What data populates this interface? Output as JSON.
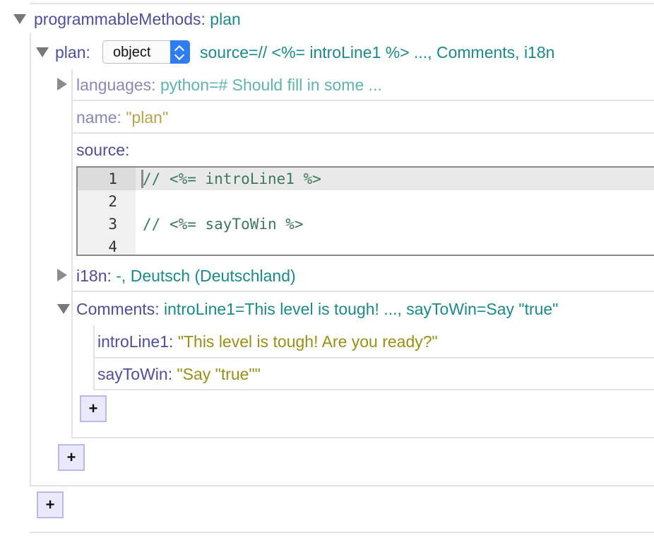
{
  "root": {
    "key": "programmableMethods",
    "summary": "plan"
  },
  "plan": {
    "key": "plan",
    "type_select": "object",
    "summary": "source=// <%= introLine1 %> ..., Comments, i18n",
    "languages": {
      "key": "languages",
      "summary": "python=# Should fill in some ..."
    },
    "name": {
      "key": "name",
      "value": "\"plan\""
    },
    "source": {
      "key": "source",
      "lines": [
        {
          "num": "1",
          "text": "// <%= introLine1 %>"
        },
        {
          "num": "2",
          "text": ""
        },
        {
          "num": "3",
          "text": "// <%= sayToWin %>"
        },
        {
          "num": "4",
          "text": ""
        }
      ]
    },
    "i18n": {
      "key": "i18n",
      "summary": "-, Deutsch (Deutschland)"
    },
    "comments": {
      "key": "Comments",
      "summary": "introLine1=This level is tough! ..., sayToWin=Say \"true\"",
      "intro": {
        "key": "introLine1",
        "value": "\"This level is tough! Are you ready?\""
      },
      "saytowin": {
        "key": "sayToWin",
        "value": "\"Say \"true\"\""
      }
    }
  },
  "colon": ":",
  "add_label": "+",
  "icons": {
    "expanded": "triangle-down-icon",
    "collapsed": "triangle-right-icon",
    "select": "up-down-chevron-icon"
  },
  "colors": {
    "key": "#4e4e9c",
    "value_teal": "#1a8a8a",
    "string": "#9a8f13",
    "select_button": "#2f7df5",
    "add_button_bg": "#e9e9fb"
  }
}
